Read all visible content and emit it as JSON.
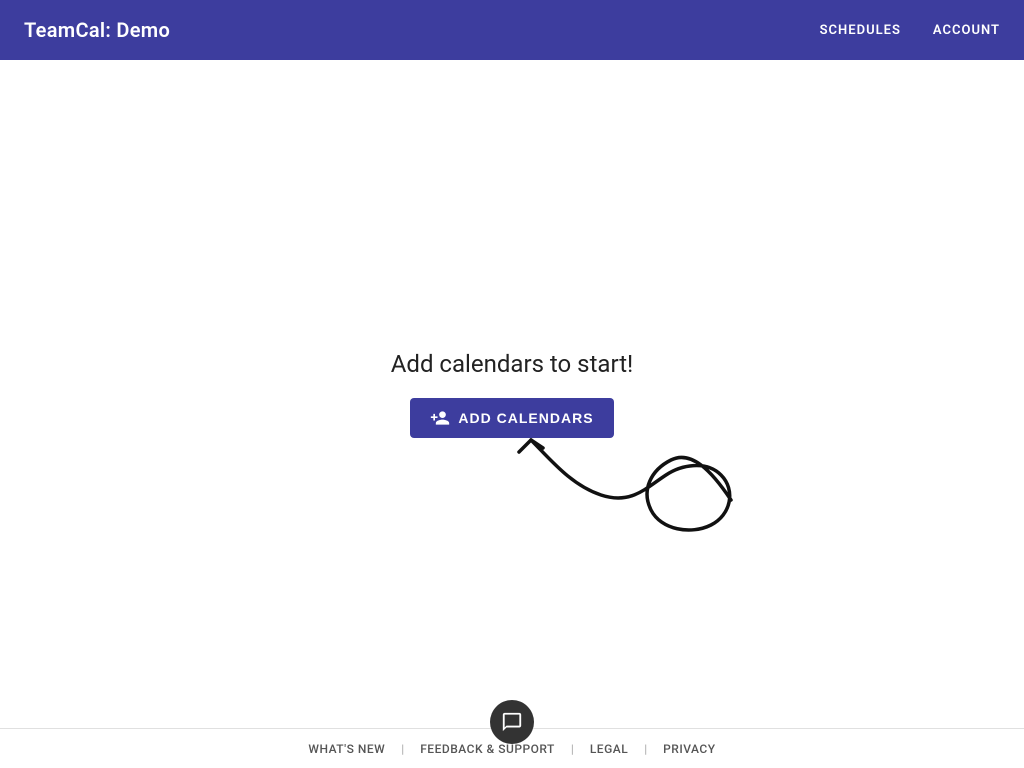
{
  "header": {
    "logo_text": "TeamCal:  Demo",
    "nav": {
      "schedules_label": "SCHEDULES",
      "account_label": "ACCOUNT"
    }
  },
  "main": {
    "prompt_text": "Add calendars to start!",
    "add_calendars_button_label": "ADD CALENDARS"
  },
  "footer": {
    "links": [
      {
        "label": "WHAT'S NEW"
      },
      {
        "label": "FEEDBACK & SUPPORT"
      },
      {
        "label": "LEGAL"
      },
      {
        "label": "PRIVACY"
      }
    ]
  },
  "colors": {
    "brand": "#3d3d9e",
    "header_bg": "#3d3d9e"
  }
}
